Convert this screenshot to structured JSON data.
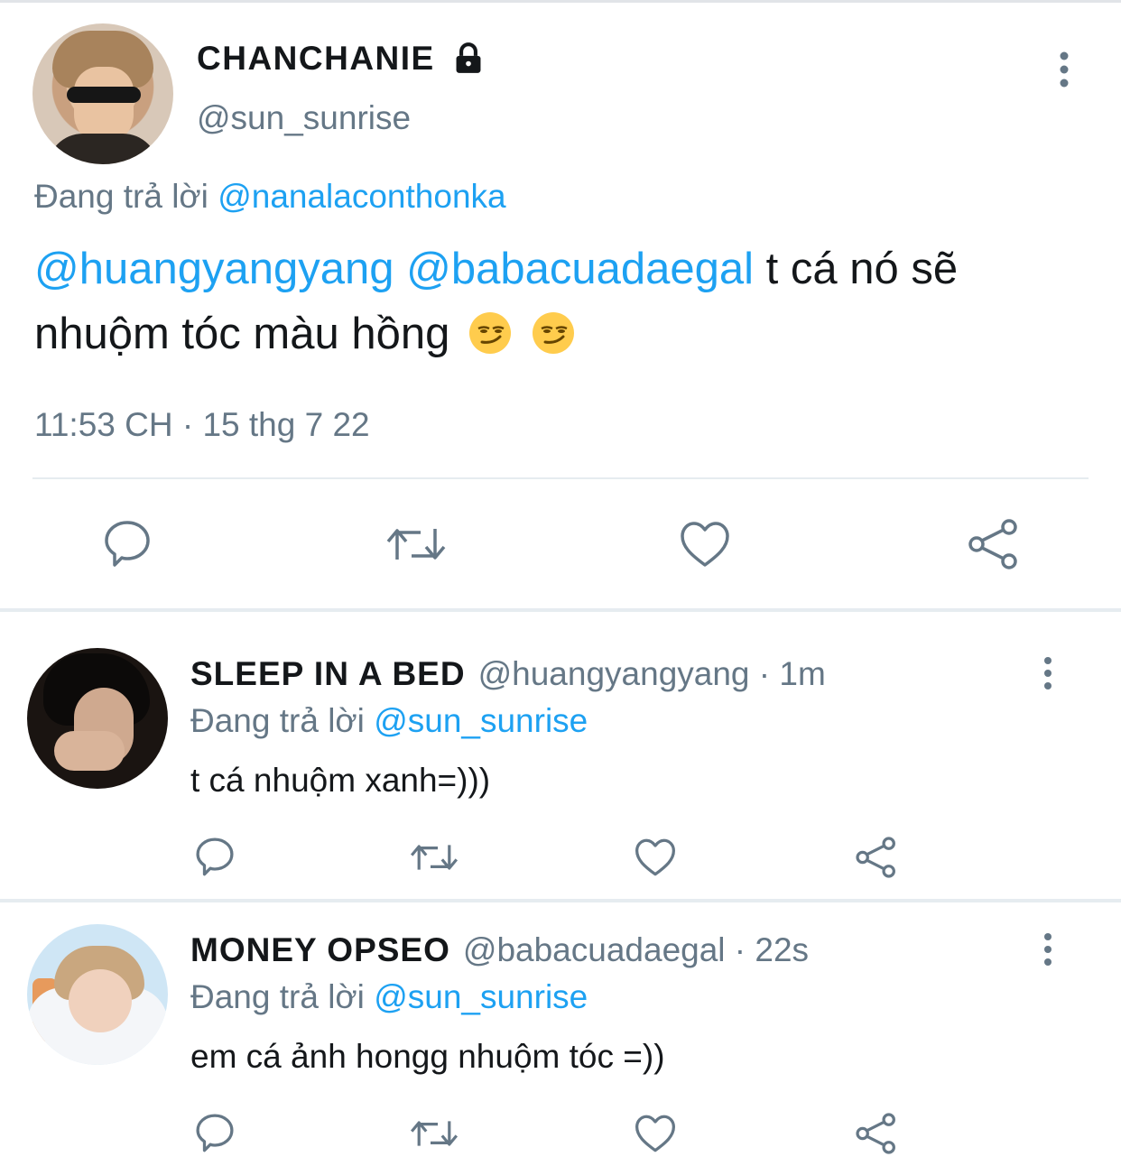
{
  "main_tweet": {
    "display_name": "CHANCHANIE",
    "handle": "@sun_sunrise",
    "reply_prefix": "Đang trả lời",
    "reply_to": "@nanalaconthonka",
    "mention_1": "@huangyangyang",
    "mention_2": "@babacuadaegal",
    "text_1": " t cá nó sẽ",
    "text_2": "nhuộm tóc màu hồng",
    "timestamp": "11:53 CH · 15 thg 7 22",
    "icons": [
      "lock-icon",
      "more-icon",
      "reply-icon",
      "retweet-icon",
      "like-icon",
      "share-icon"
    ]
  },
  "replies": [
    {
      "display_name": "SLEEP IN A BED",
      "handle_time": "@huangyangyang · 1m",
      "reply_prefix": "Đang trả lời",
      "reply_to": "@sun_sunrise",
      "text": "t cá nhuộm xanh=)))"
    },
    {
      "display_name": "MONEY OPSEO",
      "handle_time": "@babacuadaegal · 22s",
      "reply_prefix": "Đang trả lời",
      "reply_to": "@sun_sunrise",
      "text": "em cá ảnh hongg nhuộm tóc =))"
    }
  ],
  "colors": {
    "link": "#1da1f2",
    "muted": "#657786",
    "text": "#14171a",
    "divider": "#e6ecf0"
  }
}
